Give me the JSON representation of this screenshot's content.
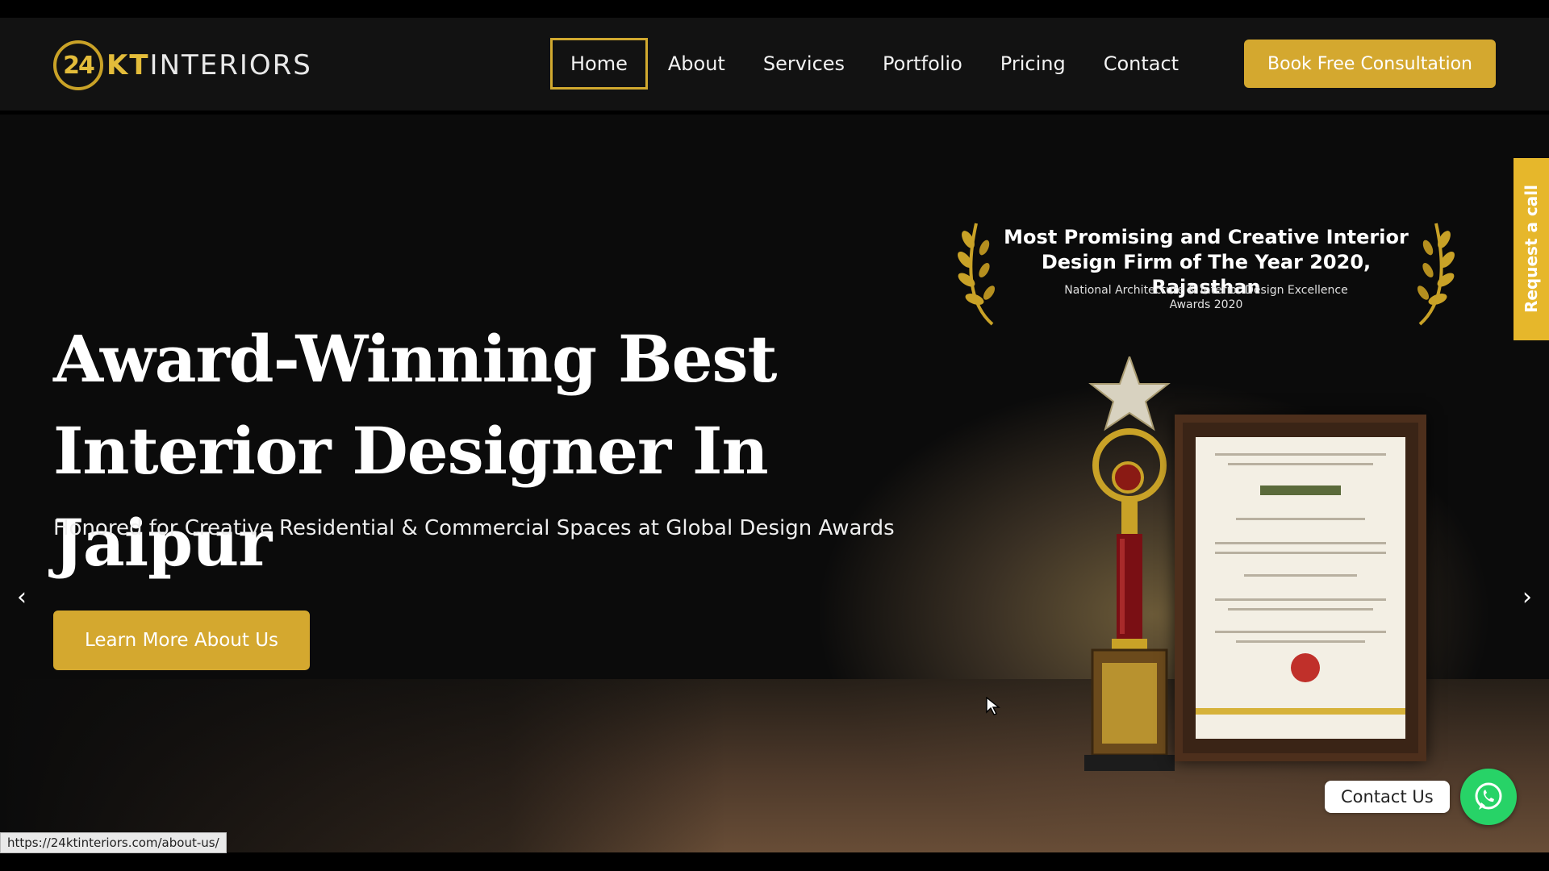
{
  "header": {
    "logo": {
      "number": "24",
      "kt": "KT",
      "name": "INTERIORS"
    },
    "nav": [
      {
        "label": "Home",
        "active": true
      },
      {
        "label": "About",
        "active": false
      },
      {
        "label": "Services",
        "active": false
      },
      {
        "label": "Portfolio",
        "active": false
      },
      {
        "label": "Pricing",
        "active": false
      },
      {
        "label": "Contact",
        "active": false
      }
    ],
    "cta_label": "Book Free Consultation"
  },
  "hero": {
    "title_line1": "Award-Winning Best",
    "title_line2": "Interior Designer In Jaipur",
    "subtitle": "Honored for Creative Residential & Commercial Spaces at Global Design Awards",
    "button_label": "Learn More About Us",
    "prev_icon": "‹",
    "next_icon": "›"
  },
  "award": {
    "title_line1": "Most Promising and Creative Interior",
    "title_line2": "Design Firm of The Year 2020, Rajasthan",
    "subtitle_line1": "National Architecture & Interior Design Excellence",
    "subtitle_line2": "Awards 2020"
  },
  "side_tab": {
    "label": "Request a call"
  },
  "contact": {
    "chip_label": "Contact Us",
    "icon": "whatsapp-icon"
  },
  "status_bar": {
    "url": "https://24ktinteriors.com/about-us/"
  },
  "colors": {
    "gold": "#d4a82f",
    "header_bg": "#121212",
    "whatsapp": "#27d367"
  }
}
